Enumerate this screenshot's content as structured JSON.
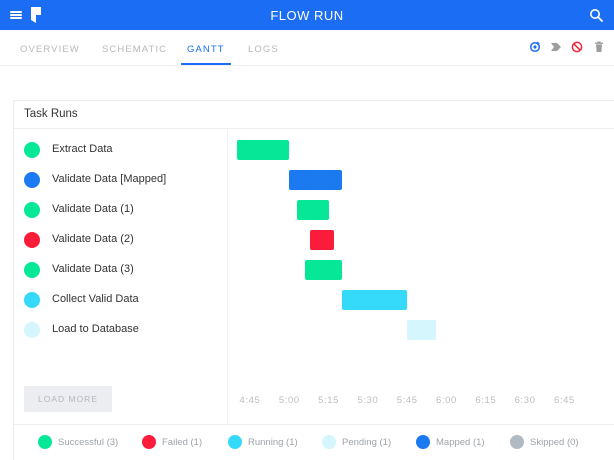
{
  "header": {
    "title": "FLOW RUN",
    "color": "#1b6ef3",
    "icons": [
      "menu-icon",
      "prefect-logo-icon",
      "search-icon"
    ]
  },
  "tabs": [
    {
      "label": "OVERVIEW",
      "active": false
    },
    {
      "label": "SCHEMATIC",
      "active": false
    },
    {
      "label": "GANTT",
      "active": true
    },
    {
      "label": "LOGS",
      "active": false
    }
  ],
  "actions": [
    {
      "name": "restart-icon",
      "color": "#1b6ef3"
    },
    {
      "name": "resume-icon",
      "color": "#9e9e9e"
    },
    {
      "name": "cancel-icon",
      "color": "#f0283c"
    },
    {
      "name": "delete-icon",
      "color": "#9e9e9e"
    }
  ],
  "panel": {
    "title": "Task Runs",
    "load_more": "LOAD MORE"
  },
  "states": {
    "successful": "#07e798",
    "failed": "#fa1c3a",
    "running": "#35d9fa",
    "pending": "#d4f6fc",
    "mapped": "#1b7af0",
    "skipped": "#b1bac2"
  },
  "tasks": [
    {
      "name": "Extract Data",
      "state": "successful",
      "start": "4:40",
      "end": "5:00"
    },
    {
      "name": "Validate Data [Mapped]",
      "state": "mapped",
      "start": "5:00",
      "end": "5:20"
    },
    {
      "name": "Validate Data (1)",
      "state": "successful",
      "start": "5:03",
      "end": "5:15"
    },
    {
      "name": "Validate Data (2)",
      "state": "failed",
      "start": "5:08",
      "end": "5:17"
    },
    {
      "name": "Validate Data (3)",
      "state": "successful",
      "start": "5:06",
      "end": "5:20"
    },
    {
      "name": "Collect Valid Data",
      "state": "running",
      "start": "5:20",
      "end": "5:45"
    },
    {
      "name": "Load to Database",
      "state": "pending",
      "start": "5:45",
      "end": "5:56"
    }
  ],
  "time_axis": {
    "ticks": [
      "4:45",
      "5:00",
      "5:15",
      "5:30",
      "5:45",
      "6:00",
      "6:15",
      "6:30",
      "6:45"
    ]
  },
  "legend": [
    {
      "label": "Successful (3)",
      "state": "successful"
    },
    {
      "label": "Failed (1)",
      "state": "failed"
    },
    {
      "label": "Running (1)",
      "state": "running"
    },
    {
      "label": "Pending (1)",
      "state": "pending"
    },
    {
      "label": "Mapped (1)",
      "state": "mapped"
    },
    {
      "label": "Skipped (0)",
      "state": "skipped"
    }
  ]
}
